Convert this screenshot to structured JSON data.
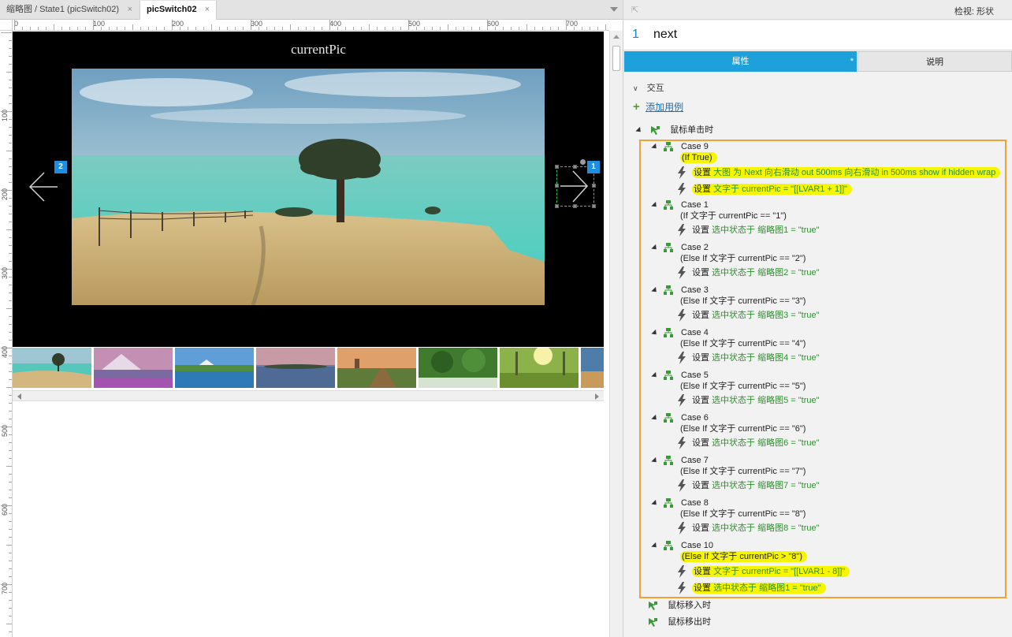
{
  "editor": {
    "tabs": [
      {
        "label": "缩略图 / State1 (picSwitch02)",
        "close": "×"
      },
      {
        "label": "picSwitch02",
        "close": "×"
      }
    ],
    "ruler_h_labels": [
      "0",
      "100",
      "200",
      "300",
      "400",
      "500",
      "600",
      "700"
    ],
    "ruler_v_labels": [
      "100",
      "200",
      "300",
      "400",
      "500",
      "600",
      "700"
    ],
    "stage": {
      "current_pic_label": "currentPic",
      "prev_badge": "2",
      "next_badge": "1"
    },
    "thumbnails": [
      "thumb-1",
      "thumb-2",
      "thumb-3",
      "thumb-4",
      "thumb-5",
      "thumb-6",
      "thumb-7",
      "thumb-8"
    ]
  },
  "inspector": {
    "header_title": "检视: 形状",
    "pin_icon": "pin-icon",
    "widget_number": "1",
    "widget_name": "next",
    "tabs": {
      "properties": "属性",
      "properties_mark": "*",
      "notes": "说明"
    },
    "interactions_label": "交互",
    "add_case_label": "添加用例",
    "events": {
      "click": "鼠标单击时",
      "mouse_enter": "鼠标移入时",
      "mouse_leave": "鼠标移出时"
    },
    "cases": [
      {
        "name": "Case 9",
        "condition": "(If True)",
        "actions": [
          {
            "verb": "设置",
            "text": "大图 为 Next 向右滑动 out 500ms 向右滑动 in 500ms show if hidden wrap"
          },
          {
            "verb": "设置",
            "text": "文字于 currentPic = \"[[LVAR1 + 1]]\""
          }
        ]
      },
      {
        "name": "Case 1",
        "condition": "(If 文字于 currentPic == \"1\")",
        "actions": [
          {
            "verb": "设置",
            "text": "选中状态于 缩略图1 = \"true\""
          }
        ]
      },
      {
        "name": "Case 2",
        "condition": "(Else If 文字于 currentPic == \"2\")",
        "actions": [
          {
            "verb": "设置",
            "text": "选中状态于 缩略图2 = \"true\""
          }
        ]
      },
      {
        "name": "Case 3",
        "condition": "(Else If 文字于 currentPic == \"3\")",
        "actions": [
          {
            "verb": "设置",
            "text": "选中状态于 缩略图3 = \"true\""
          }
        ]
      },
      {
        "name": "Case 4",
        "condition": "(Else If 文字于 currentPic == \"4\")",
        "actions": [
          {
            "verb": "设置",
            "text": "选中状态于 缩略图4 = \"true\""
          }
        ]
      },
      {
        "name": "Case 5",
        "condition": "(Else If 文字于 currentPic == \"5\")",
        "actions": [
          {
            "verb": "设置",
            "text": "选中状态于 缩略图5 = \"true\""
          }
        ]
      },
      {
        "name": "Case 6",
        "condition": "(Else If 文字于 currentPic == \"6\")",
        "actions": [
          {
            "verb": "设置",
            "text": "选中状态于 缩略图6 = \"true\""
          }
        ]
      },
      {
        "name": "Case 7",
        "condition": "(Else If 文字于 currentPic == \"7\")",
        "actions": [
          {
            "verb": "设置",
            "text": "选中状态于 缩略图7 = \"true\""
          }
        ]
      },
      {
        "name": "Case 8",
        "condition": "(Else If 文字于 currentPic == \"8\")",
        "actions": [
          {
            "verb": "设置",
            "text": "选中状态于 缩略图8 = \"true\""
          }
        ]
      },
      {
        "name": "Case 10",
        "condition": "(Else If 文字于 currentPic > \"8\")",
        "actions": [
          {
            "verb": "设置",
            "text": "文字于 currentPic = \"[[LVAR1 - 8]]\""
          },
          {
            "verb": "设置",
            "text": "选中状态于 缩略图1 = \"true\""
          }
        ]
      }
    ]
  },
  "colors": {
    "accent_blue": "#1ea0db",
    "highlight_yellow": "#f6f600",
    "case_box_orange": "#f0a237",
    "action_green": "#2e8f2e",
    "badge_blue": "#1e8ee0"
  }
}
